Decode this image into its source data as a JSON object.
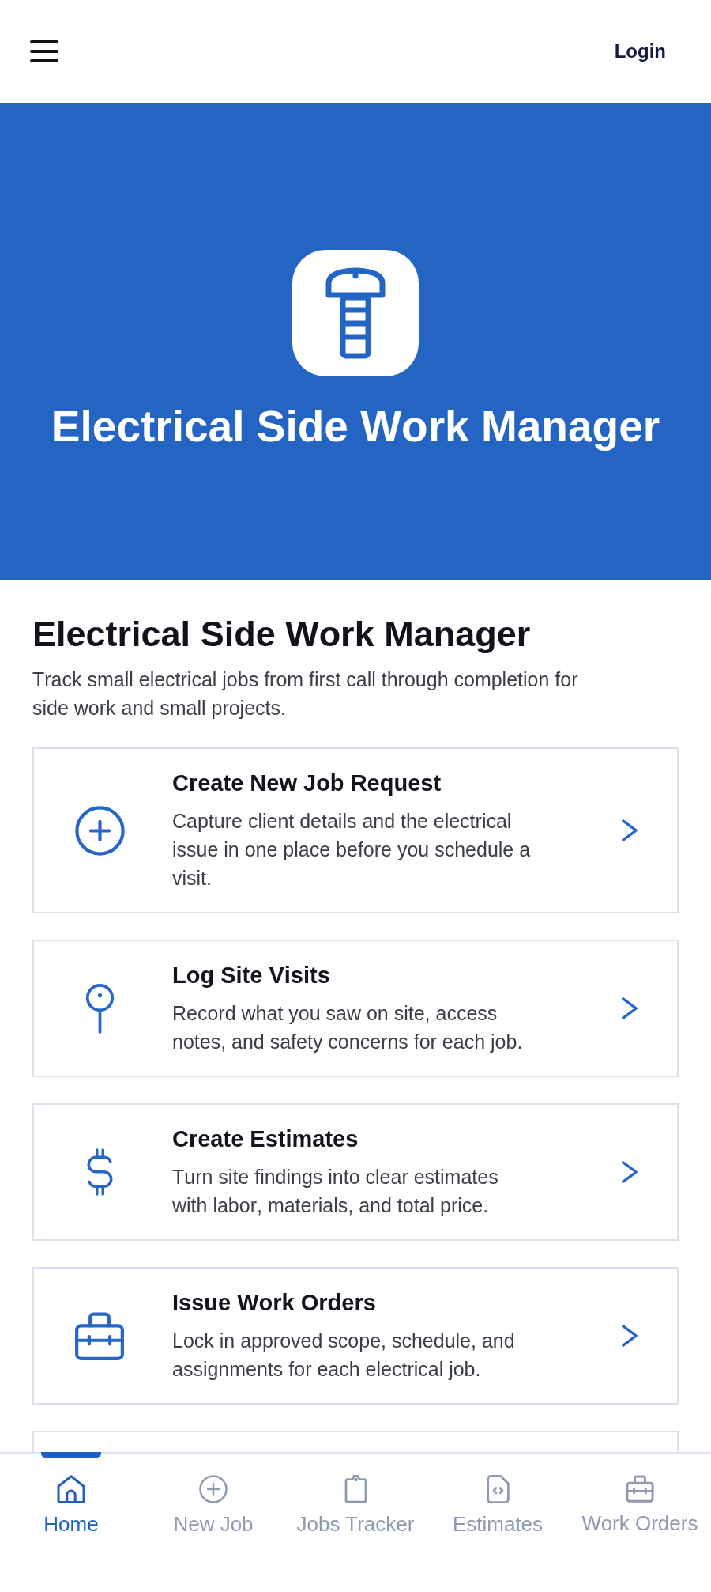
{
  "header": {
    "login": "Login"
  },
  "hero": {
    "title": "Electrical Side Work Manager"
  },
  "intro": {
    "title": "Electrical Side Work Manager",
    "description": "Track small electrical jobs from first call through completion for side work and small projects."
  },
  "cards": [
    {
      "title": "Create New Job Request",
      "description": "Capture client details and the electrical issue in one place before you schedule a visit."
    },
    {
      "title": "Log Site Visits",
      "description": "Record what you saw on site, access notes, and safety concerns for each job."
    },
    {
      "title": "Create Estimates",
      "description": "Turn site findings into clear estimates with labor, materials, and total price."
    },
    {
      "title": "Issue Work Orders",
      "description": "Lock in approved scope, schedule, and assignments for each electrical job."
    }
  ],
  "more_cards_below": true,
  "bottom_nav": [
    {
      "label": "Home",
      "selected": true
    },
    {
      "label": "New Job",
      "selected": false
    },
    {
      "label": "Jobs Tracker",
      "selected": false
    },
    {
      "label": "Estimates",
      "selected": false
    },
    {
      "label": "Work Orders",
      "selected": false
    }
  ]
}
